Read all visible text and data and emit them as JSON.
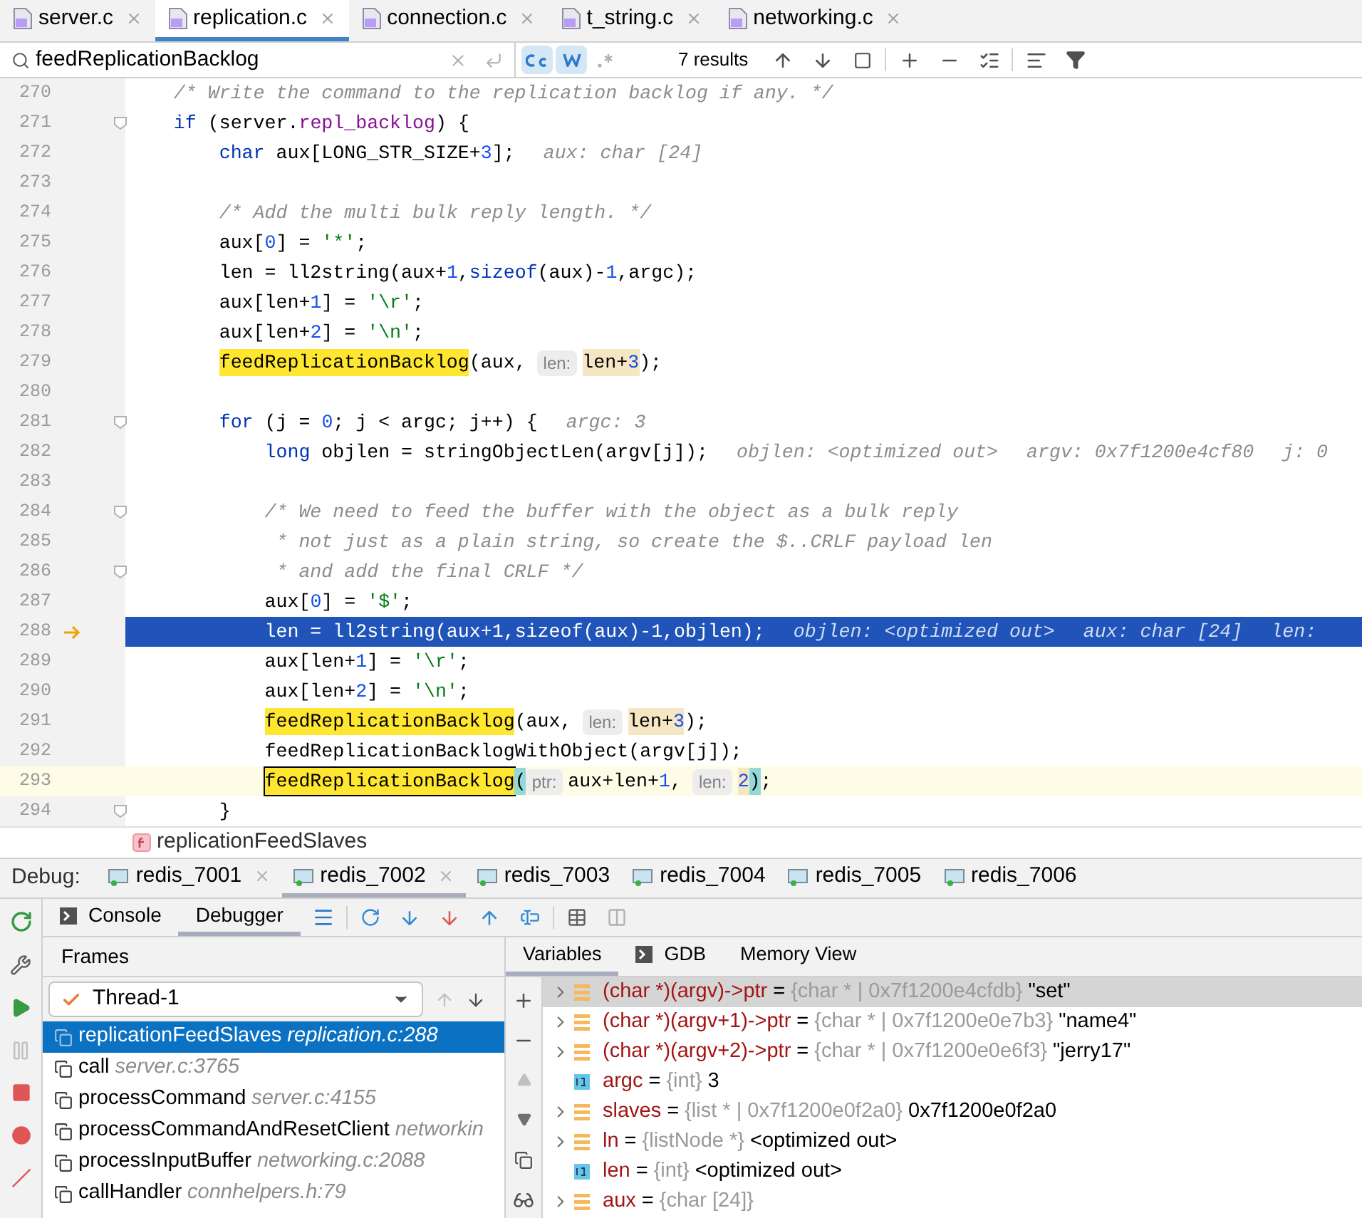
{
  "file_tabs": [
    {
      "label": "server.c",
      "selected": false
    },
    {
      "label": "replication.c",
      "selected": true
    },
    {
      "label": "connection.c",
      "selected": false
    },
    {
      "label": "t_string.c",
      "selected": false
    },
    {
      "label": "networking.c",
      "selected": false
    }
  ],
  "search": {
    "value": "feedReplicationBacklog",
    "match_case": true,
    "words": true,
    "regex": false,
    "results": "7 results"
  },
  "code_lines": [
    {
      "number": "270",
      "execution_point": false,
      "caret_line": false,
      "fold": false,
      "tokens": [
        {
          "text": "    /* Write the command to the replication backlog if any. */",
          "kind": "comment"
        }
      ]
    },
    {
      "number": "271",
      "execution_point": false,
      "caret_line": false,
      "fold": true,
      "tokens": [
        {
          "text": "    if",
          "kind": "kw"
        },
        {
          "text": " (server.",
          "kind": "plain"
        },
        {
          "text": "repl_backlog",
          "kind": "field"
        },
        {
          "text": ") {",
          "kind": "plain"
        }
      ]
    },
    {
      "number": "272",
      "execution_point": false,
      "caret_line": false,
      "fold": false,
      "tokens": [
        {
          "text": "        char",
          "kind": "kw"
        },
        {
          "text": " aux[LONG_STR_SIZE+",
          "kind": "plain"
        },
        {
          "text": "3",
          "kind": "num"
        },
        {
          "text": "];",
          "kind": "plain"
        },
        {
          "text": "aux: char [24]",
          "kind": "inline"
        }
      ]
    },
    {
      "number": "273",
      "execution_point": false,
      "caret_line": false,
      "fold": false
    },
    {
      "number": "274",
      "execution_point": false,
      "caret_line": false,
      "fold": false,
      "tokens": [
        {
          "text": "        /* Add the multi bulk reply length. */",
          "kind": "comment"
        }
      ]
    },
    {
      "number": "275",
      "execution_point": false,
      "caret_line": false,
      "fold": false,
      "tokens": [
        {
          "text": "        aux[",
          "kind": "plain"
        },
        {
          "text": "0",
          "kind": "num"
        },
        {
          "text": "] = ",
          "kind": "plain"
        },
        {
          "text": "'*'",
          "kind": "str"
        },
        {
          "text": ";",
          "kind": "plain"
        }
      ]
    },
    {
      "number": "276",
      "execution_point": false,
      "caret_line": false,
      "fold": false,
      "tokens": [
        {
          "text": "        len = ll2string(aux+",
          "kind": "plain"
        },
        {
          "text": "1",
          "kind": "num"
        },
        {
          "text": ",",
          "kind": "plain"
        },
        {
          "text": "sizeof",
          "kind": "kw"
        },
        {
          "text": "(aux)-",
          "kind": "plain"
        },
        {
          "text": "1",
          "kind": "num"
        },
        {
          "text": ",argc);",
          "kind": "plain"
        }
      ]
    },
    {
      "number": "277",
      "execution_point": false,
      "caret_line": false,
      "fold": false,
      "tokens": [
        {
          "text": "        aux[len+",
          "kind": "plain"
        },
        {
          "text": "1",
          "kind": "num"
        },
        {
          "text": "] = ",
          "kind": "plain"
        },
        {
          "text": "'\\r'",
          "kind": "str"
        },
        {
          "text": ";",
          "kind": "plain"
        }
      ]
    },
    {
      "number": "278",
      "execution_point": false,
      "caret_line": false,
      "fold": false,
      "tokens": [
        {
          "text": "        aux[len+",
          "kind": "plain"
        },
        {
          "text": "2",
          "kind": "num"
        },
        {
          "text": "] = ",
          "kind": "plain"
        },
        {
          "text": "'\\n'",
          "kind": "str"
        },
        {
          "text": ";",
          "kind": "plain"
        }
      ]
    },
    {
      "number": "279",
      "execution_point": false,
      "caret_line": false,
      "fold": false,
      "tokens": [
        {
          "text": "        feedReplicationBacklog",
          "kind": "match"
        },
        {
          "text": "(aux, ",
          "kind": "plain"
        },
        {
          "text": "len:",
          "kind": "hint"
        },
        {
          "text": "len+",
          "kind": "arg"
        },
        {
          "text": "3",
          "kind": "argnum"
        },
        {
          "text": ");",
          "kind": "plain"
        }
      ]
    },
    {
      "number": "280",
      "execution_point": false,
      "caret_line": false,
      "fold": false
    },
    {
      "number": "281",
      "execution_point": false,
      "caret_line": false,
      "fold": true,
      "tokens": [
        {
          "text": "        for",
          "kind": "kw"
        },
        {
          "text": " (j = ",
          "kind": "plain"
        },
        {
          "text": "0",
          "kind": "num"
        },
        {
          "text": "; j < argc; j++) {",
          "kind": "plain"
        },
        {
          "text": "argc: 3",
          "kind": "inline"
        }
      ]
    },
    {
      "number": "282",
      "execution_point": false,
      "caret_line": false,
      "fold": false,
      "tokens": [
        {
          "text": "            long",
          "kind": "kw"
        },
        {
          "text": " objlen = stringObjectLen(argv[j]);",
          "kind": "plain"
        },
        {
          "text": "objlen: <optimized out>",
          "kind": "inline"
        },
        {
          "text": "argv: 0x7f1200e4cf80",
          "kind": "inline"
        },
        {
          "text": "j: 0",
          "kind": "inline"
        }
      ]
    },
    {
      "number": "283",
      "execution_point": false,
      "caret_line": false,
      "fold": false
    },
    {
      "number": "284",
      "execution_point": false,
      "caret_line": false,
      "fold": true,
      "tokens": [
        {
          "text": "            /* We need to feed the buffer with the object as a bulk reply",
          "kind": "comment"
        }
      ]
    },
    {
      "number": "285",
      "execution_point": false,
      "caret_line": false,
      "fold": false,
      "tokens": [
        {
          "text": "             * not just as a plain string, so create the $..CRLF payload len",
          "kind": "comment"
        }
      ]
    },
    {
      "number": "286",
      "execution_point": false,
      "caret_line": false,
      "fold": true,
      "tokens": [
        {
          "text": "             * and add the final CRLF */",
          "kind": "comment"
        }
      ]
    },
    {
      "number": "287",
      "execution_point": false,
      "caret_line": false,
      "fold": false,
      "tokens": [
        {
          "text": "            aux[",
          "kind": "plain"
        },
        {
          "text": "0",
          "kind": "num"
        },
        {
          "text": "] = ",
          "kind": "plain"
        },
        {
          "text": "'$'",
          "kind": "str"
        },
        {
          "text": ";",
          "kind": "plain"
        }
      ]
    },
    {
      "number": "288",
      "execution_point": true,
      "caret_line": false,
      "fold": false,
      "tokens": [
        {
          "text": "            len = ll2string(aux+1,sizeof(aux)-1,objlen);",
          "kind": "plain"
        },
        {
          "text": "objlen: <optimized out>",
          "kind": "inline"
        },
        {
          "text": "aux: char [24]",
          "kind": "inline"
        },
        {
          "text": "len:",
          "kind": "inline"
        }
      ]
    },
    {
      "number": "289",
      "execution_point": false,
      "caret_line": false,
      "fold": false,
      "tokens": [
        {
          "text": "            aux[len+",
          "kind": "plain"
        },
        {
          "text": "1",
          "kind": "num"
        },
        {
          "text": "] = ",
          "kind": "plain"
        },
        {
          "text": "'\\r'",
          "kind": "str"
        },
        {
          "text": ";",
          "kind": "plain"
        }
      ]
    },
    {
      "number": "290",
      "execution_point": false,
      "caret_line": false,
      "fold": false,
      "tokens": [
        {
          "text": "            aux[len+",
          "kind": "plain"
        },
        {
          "text": "2",
          "kind": "num"
        },
        {
          "text": "] = ",
          "kind": "plain"
        },
        {
          "text": "'\\n'",
          "kind": "str"
        },
        {
          "text": ";",
          "kind": "plain"
        }
      ]
    },
    {
      "number": "291",
      "execution_point": false,
      "caret_line": false,
      "fold": false,
      "tokens": [
        {
          "text": "            feedReplicationBacklog",
          "kind": "match"
        },
        {
          "text": "(aux, ",
          "kind": "plain"
        },
        {
          "text": "len:",
          "kind": "hint"
        },
        {
          "text": "len+",
          "kind": "arg"
        },
        {
          "text": "3",
          "kind": "argnum"
        },
        {
          "text": ");",
          "kind": "plain"
        }
      ]
    },
    {
      "number": "292",
      "execution_point": false,
      "caret_line": false,
      "fold": false,
      "tokens": [
        {
          "text": "            feedReplicationBacklogWithObject(argv[j]);",
          "kind": "plain"
        }
      ]
    },
    {
      "number": "293",
      "execution_point": false,
      "caret_line": true,
      "fold": false,
      "tokens": [
        {
          "text": "            feedReplicationBacklog",
          "kind": "current"
        },
        {
          "text": "(",
          "kind": "paren"
        },
        {
          "text": "ptr:",
          "kind": "hint"
        },
        {
          "text": "aux+len+",
          "kind": "plain"
        },
        {
          "text": "1",
          "kind": "num"
        },
        {
          "text": ", ",
          "kind": "plain"
        },
        {
          "text": "len:",
          "kind": "hint"
        },
        {
          "text": "2",
          "kind": "argnum"
        },
        {
          "text": ")",
          "kind": "paren"
        },
        {
          "text": ";",
          "kind": "plain"
        }
      ]
    },
    {
      "number": "294",
      "execution_point": false,
      "caret_line": false,
      "fold": true,
      "tokens": [
        {
          "text": "        }",
          "kind": "plain"
        }
      ]
    }
  ],
  "breadcrumb": "replicationFeedSlaves",
  "debug": {
    "label": "Debug:",
    "sessions": [
      {
        "label": "redis_7001",
        "selected": false
      },
      {
        "label": "redis_7002",
        "selected": true
      },
      {
        "label": "redis_7003",
        "selected": false
      },
      {
        "label": "redis_7004",
        "selected": false
      },
      {
        "label": "redis_7005",
        "selected": false
      },
      {
        "label": "redis_7006",
        "selected": false
      }
    ],
    "subtabs": [
      {
        "label": "Console",
        "selected": false
      },
      {
        "label": "Debugger",
        "selected": true
      }
    ],
    "frames_title": "Frames",
    "thread": "Thread-1",
    "frames": [
      {
        "function": "replicationFeedSlaves",
        "location": "replication.c:288",
        "selected": true
      },
      {
        "function": "call",
        "location": "server.c:3765",
        "selected": false
      },
      {
        "function": "processCommand",
        "location": "server.c:4155",
        "selected": false
      },
      {
        "function": "processCommandAndResetClient",
        "location": "networkin",
        "selected": false
      },
      {
        "function": "processInputBuffer",
        "location": "networking.c:2088",
        "selected": false
      },
      {
        "function": "callHandler",
        "location": "connhelpers.h:79",
        "selected": false
      }
    ],
    "var_tabs": [
      {
        "label": "Variables",
        "selected": true
      },
      {
        "label": "GDB",
        "selected": false
      },
      {
        "label": "Memory View",
        "selected": false
      }
    ],
    "variables": [
      {
        "kind": "struct",
        "expandable": true,
        "selected": true,
        "name": "(char *)(argv)->ptr",
        "equals": "=",
        "type": "{char * | 0x7f1200e4cfdb}",
        "value": "\"set\""
      },
      {
        "kind": "struct",
        "expandable": true,
        "selected": false,
        "name": "(char *)(argv+1)->ptr",
        "equals": "=",
        "type": "{char * | 0x7f1200e0e7b3}",
        "value": "\"name4\""
      },
      {
        "kind": "struct",
        "expandable": true,
        "selected": false,
        "name": "(char *)(argv+2)->ptr",
        "equals": "=",
        "type": "{char * | 0x7f1200e0e6f3}",
        "value": "\"jerry17\""
      },
      {
        "kind": "int",
        "expandable": false,
        "selected": false,
        "name": "argc",
        "equals": "=",
        "type": "{int}",
        "value": "3"
      },
      {
        "kind": "struct",
        "expandable": true,
        "selected": false,
        "name": "slaves",
        "equals": "=",
        "type": "{list * | 0x7f1200e0f2a0}",
        "value": "0x7f1200e0f2a0"
      },
      {
        "kind": "struct",
        "expandable": true,
        "selected": false,
        "name": "ln",
        "equals": "=",
        "type": "{listNode *}",
        "value": "<optimized out>"
      },
      {
        "kind": "int",
        "expandable": false,
        "selected": false,
        "name": "len",
        "equals": "=",
        "type": "{int}",
        "value": "<optimized out>"
      },
      {
        "kind": "struct",
        "expandable": true,
        "selected": false,
        "name": "aux",
        "equals": "=",
        "type": "{char [24]}"
      }
    ]
  }
}
